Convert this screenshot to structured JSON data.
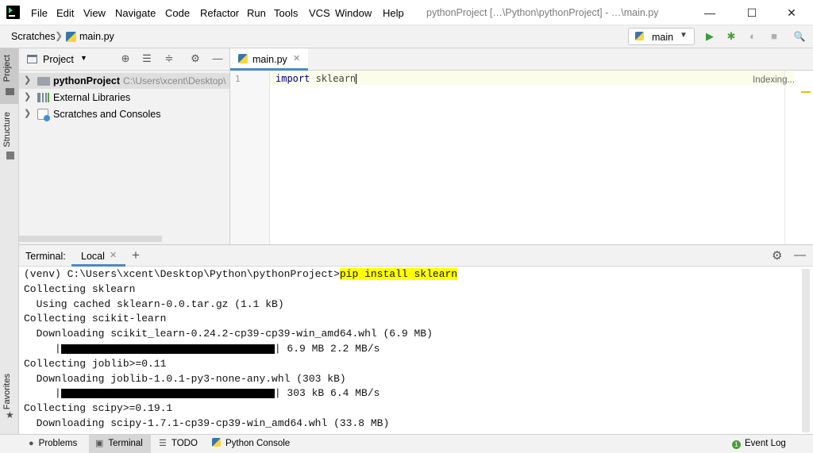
{
  "menu": [
    "File",
    "Edit",
    "View",
    "Navigate",
    "Code",
    "Refactor",
    "Run",
    "Tools",
    "VCS",
    "Window",
    "Help"
  ],
  "window_title": "pythonProject […\\Python\\pythonProject] - …\\main.py",
  "window_controls": {
    "minimize": "—",
    "maximize": "☐",
    "close": "✕"
  },
  "breadcrumb": {
    "scratches": "Scratches",
    "separator": "❯",
    "file": "main.py"
  },
  "run_config": {
    "label": "main",
    "arrow": "▼"
  },
  "toolbar_icons": {
    "run": "▶",
    "debug": "✱",
    "coverage": "◐",
    "stop": "■",
    "search": "🔍"
  },
  "left_strip": {
    "project": "Project",
    "structure": "Structure",
    "favorites": "Favorites"
  },
  "project_panel": {
    "title": "Project",
    "arrow": "▼",
    "tree": [
      {
        "label": "pythonProject",
        "path": "C:\\Users\\xcent\\Desktop\\"
      },
      {
        "label": "External Libraries"
      },
      {
        "label": "Scratches and Consoles"
      }
    ]
  },
  "editor": {
    "tab_label": "main.py",
    "tab_close": "✕",
    "line_number": "1",
    "code_keyword": "import",
    "code_rest": " sklearn",
    "indexing": "Indexing..."
  },
  "terminal": {
    "title": "Terminal:",
    "tab_label": "Local",
    "tab_close": "✕",
    "add": "+",
    "prompt": "(venv) C:\\Users\\xcent\\Desktop\\Python\\pythonProject>",
    "command": "pip install sklearn",
    "lines": [
      "Collecting sklearn",
      "  Using cached sklearn-0.0.tar.gz (1.1 kB)",
      "Collecting scikit-learn",
      "  Downloading scikit_learn-0.24.2-cp39-cp39-win_amd64.whl (6.9 MB)"
    ],
    "progress1_suffix": "| 6.9 MB 2.2 MB/s",
    "lines2": [
      "Collecting joblib>=0.11",
      "  Downloading joblib-1.0.1-py3-none-any.whl (303 kB)"
    ],
    "progress2_suffix": "| 303 kB 6.4 MB/s",
    "lines3": [
      "Collecting scipy>=0.19.1",
      "  Downloading scipy-1.7.1-cp39-cp39-win_amd64.whl (33.8 MB)"
    ],
    "progress_prefix": "     |"
  },
  "statusbar": {
    "problems": "Problems",
    "terminal": "Terminal",
    "todo": "TODO",
    "python_console": "Python Console",
    "event_log": "Event Log",
    "event_count": "1"
  }
}
